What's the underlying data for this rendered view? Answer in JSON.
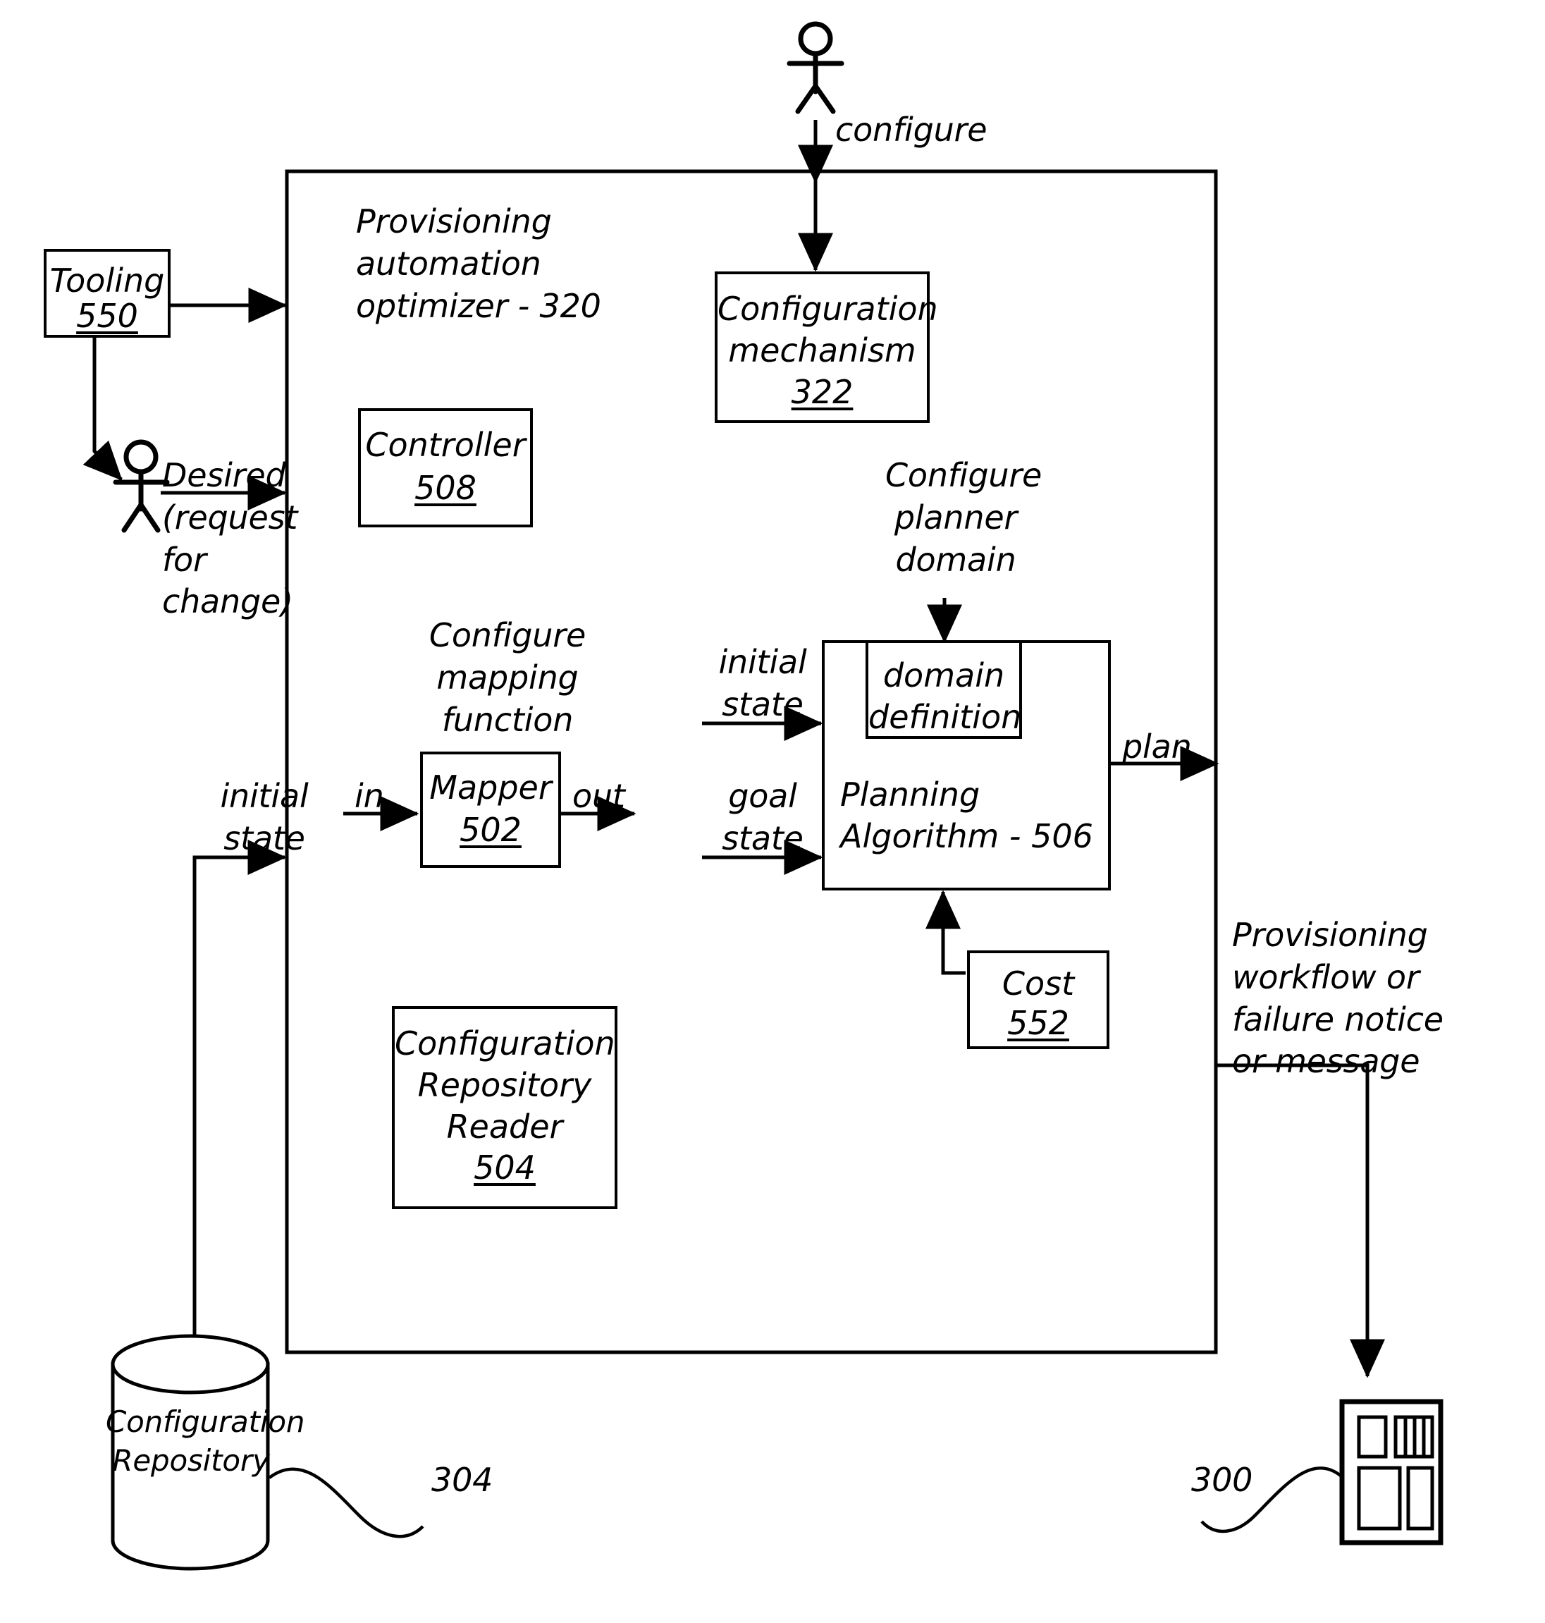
{
  "diagram": {
    "main_container_label": "Provisioning\nautomation\noptimizer - 320",
    "actors": {
      "top_actor_name": "user-actor",
      "top_actor_edge_label": "configure",
      "left_actor_name": "requester-actor",
      "left_actor_edge_label": "Desired\n(request\nfor\nchange)"
    },
    "boxes": {
      "tooling": {
        "title": "Tooling",
        "ref": "550"
      },
      "configuration_mechanism": {
        "title": "Configuration\nmechanism",
        "ref": "322"
      },
      "controller": {
        "title": "Controller",
        "ref": "508"
      },
      "mapper": {
        "title": "Mapper",
        "ref": "502"
      },
      "configuration_repository_reader": {
        "title": "Configuration\nRepository\nReader",
        "ref": "504"
      },
      "planning_algorithm": {
        "title": "Planning\nAlgorithm - 506"
      },
      "domain_definition": {
        "title": "domain\ndefinition"
      },
      "cost": {
        "title": "Cost",
        "ref": "552"
      }
    },
    "edge_labels": {
      "configure_mapping_function": "Configure\nmapping\nfunction",
      "mapper_in": "in",
      "mapper_out": "out",
      "configure_planner_domain": "Configure\nplanner\ndomain",
      "initial_state_planner": "initial\nstate",
      "goal_state_planner": "goal\nstate",
      "plan_output": "plan",
      "initial_state_repo": "initial\nstate",
      "provisioning_output": "Provisioning\nworkflow or\nfailure notice\nor message"
    },
    "external": {
      "configuration_repository_label": "Configuration\nRepository",
      "configuration_repository_ref": "304",
      "target_server_ref": "300"
    }
  }
}
